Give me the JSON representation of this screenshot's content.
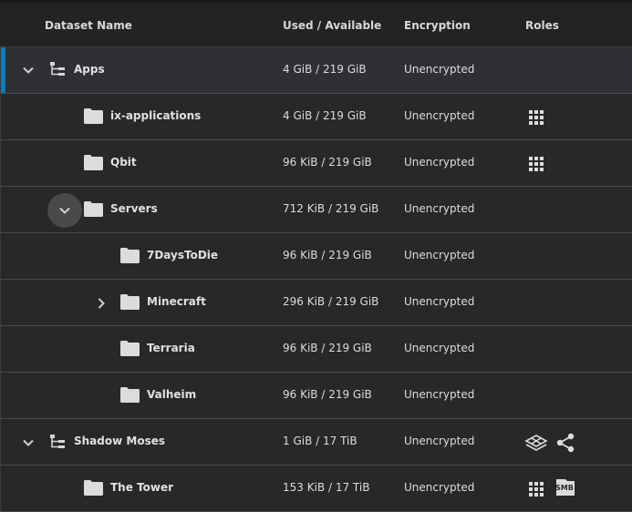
{
  "header": {
    "dataset_name": "Dataset Name",
    "used_available": "Used / Available",
    "encryption": "Encryption",
    "roles": "Roles"
  },
  "rows": [
    {
      "name": "Apps",
      "used": "4 GiB / 219 GiB",
      "encryption": "Unencrypted",
      "icon": "pool-tree-icon",
      "toggle": "chevron-down-icon"
    },
    {
      "name": "ix-applications",
      "used": "4 GiB / 219 GiB",
      "encryption": "Unencrypted",
      "icon": "folder-icon",
      "roles": [
        "apps-grid-icon"
      ]
    },
    {
      "name": "Qbit",
      "used": "96 KiB / 219 GiB",
      "encryption": "Unencrypted",
      "icon": "folder-icon",
      "roles": [
        "apps-grid-icon"
      ]
    },
    {
      "name": "Servers",
      "used": "712 KiB / 219 GiB",
      "encryption": "Unencrypted",
      "icon": "folder-icon",
      "toggle": "chevron-down-icon"
    },
    {
      "name": "7DaysToDie",
      "used": "96 KiB / 219 GiB",
      "encryption": "Unencrypted",
      "icon": "folder-icon"
    },
    {
      "name": "Minecraft",
      "used": "296 KiB / 219 GiB",
      "encryption": "Unencrypted",
      "icon": "folder-icon",
      "toggle": "chevron-right-icon"
    },
    {
      "name": "Terraria",
      "used": "96 KiB / 219 GiB",
      "encryption": "Unencrypted",
      "icon": "folder-icon"
    },
    {
      "name": "Valheim",
      "used": "96 KiB / 219 GiB",
      "encryption": "Unencrypted",
      "icon": "folder-icon"
    },
    {
      "name": "Shadow Moses",
      "used": "1 GiB / 17 TiB",
      "encryption": "Unencrypted",
      "icon": "pool-tree-icon",
      "toggle": "chevron-down-icon",
      "roles": [
        "system-dataset-icon",
        "share-icon"
      ]
    },
    {
      "name": "The Tower",
      "used": "153 KiB / 17 TiB",
      "encryption": "Unencrypted",
      "icon": "folder-icon",
      "roles": [
        "apps-grid-icon",
        "smb-share-icon"
      ],
      "smb_label": "SMB"
    }
  ],
  "colors": {
    "accent": "#0a7bc2",
    "background": "#282828",
    "selected_row": "#2f3033"
  }
}
